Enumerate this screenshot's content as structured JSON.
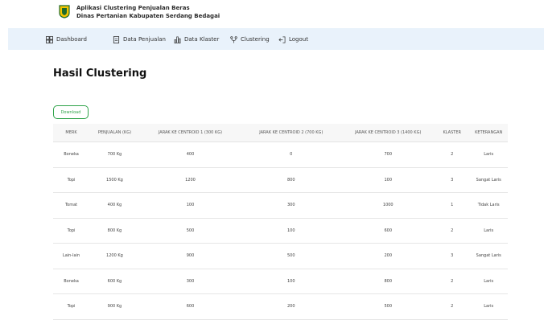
{
  "app": {
    "title": "Aplikasi Clustering Penjualan Beras",
    "subtitle": "Dinas Pertanian Kabupaten Serdang Bedagai"
  },
  "nav": [
    {
      "label": "Dashboard",
      "icon": "grid-icon"
    },
    {
      "label": "Data Penjualan",
      "icon": "document-icon"
    },
    {
      "label": "Data Klaster",
      "icon": "bar-chart-icon"
    },
    {
      "label": "Clustering",
      "icon": "branch-icon"
    },
    {
      "label": "Logout",
      "icon": "logout-icon"
    }
  ],
  "page": {
    "title": "Hasil Clustering",
    "download_label": "Download"
  },
  "table": {
    "headers": [
      "MERK",
      "PENJUALAN (KG)",
      "JARAK KE CENTROID 1 (300 KG)",
      "JARAK KE CENTROID 2 (700 KG)",
      "JARAK KE CENTROID 3 (1400 KG)",
      "KLASTER",
      "KETERANGAN"
    ],
    "rows": [
      [
        "Boneka",
        "700 Kg",
        "400",
        "0",
        "700",
        "2",
        "Laris"
      ],
      [
        "Topi",
        "1500 Kg",
        "1200",
        "800",
        "100",
        "3",
        "Sangat Laris"
      ],
      [
        "Tomat",
        "400 Kg",
        "100",
        "300",
        "1000",
        "1",
        "Tidak Laris"
      ],
      [
        "Topi",
        "800 Kg",
        "500",
        "100",
        "600",
        "2",
        "Laris"
      ],
      [
        "Lain-lain",
        "1200 Kg",
        "900",
        "500",
        "200",
        "3",
        "Sangat Laris"
      ],
      [
        "Boneka",
        "600 Kg",
        "300",
        "100",
        "800",
        "2",
        "Laris"
      ],
      [
        "Topi",
        "900 Kg",
        "600",
        "200",
        "500",
        "2",
        "Laris"
      ]
    ]
  },
  "colors": {
    "accent": "#2fa34a",
    "nav_bg": "#e9f2fb"
  }
}
